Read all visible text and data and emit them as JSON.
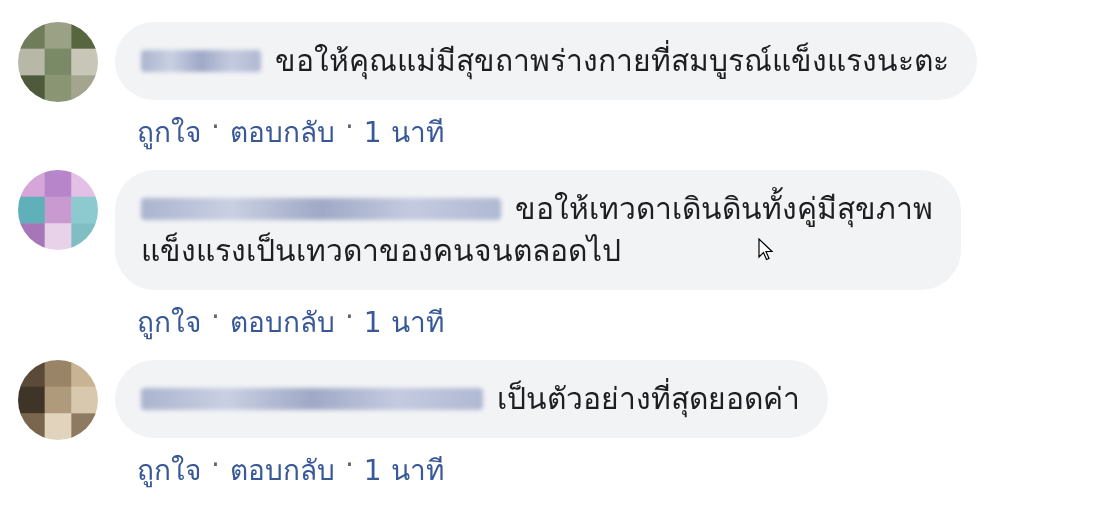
{
  "comments": [
    {
      "text_lines": [
        "ขอให้คุณแม่มีสุขถาพร่างกายที่สมบูรณ์แข็งแรงนะตะ"
      ],
      "actions": [
        {
          "label": "ถูกใจ",
          "kind": "link"
        },
        {
          "label": "·",
          "kind": "separator"
        },
        {
          "label": "ตอบกลับ",
          "kind": "link"
        },
        {
          "label": "·",
          "kind": "separator"
        },
        {
          "label": "1 นาที",
          "kind": "link"
        }
      ]
    },
    {
      "text_lines": [
        "ขอให้เทวดาเดินดินทั้งคู่มีสุขภาพ",
        "แข็งแรงเป็นเทวดาของคนจนตลอดไป"
      ],
      "actions": [
        {
          "label": "ถูกใจ",
          "kind": "link"
        },
        {
          "label": "·",
          "kind": "separator"
        },
        {
          "label": "ตอบกลับ",
          "kind": "link"
        },
        {
          "label": "·",
          "kind": "separator"
        },
        {
          "label": "1 นาที",
          "kind": "link"
        }
      ]
    },
    {
      "text_lines": [
        "เป็นตัวอย่างที่สุดยอดค่า"
      ],
      "actions": [
        {
          "label": "ถูกใจ",
          "kind": "link"
        },
        {
          "label": "·",
          "kind": "separator"
        },
        {
          "label": "ตอบกลับ",
          "kind": "link"
        },
        {
          "label": "·",
          "kind": "separator"
        },
        {
          "label": "1 นาที",
          "kind": "link"
        }
      ]
    }
  ]
}
